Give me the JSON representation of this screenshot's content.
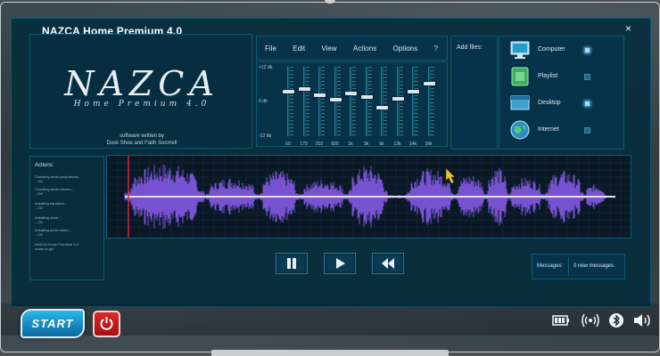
{
  "window": {
    "title": "NAZCA Home Premium 4.0",
    "close_label": "×"
  },
  "logo": {
    "wordmark": "NAZCA",
    "subtitle": "Home Premium 4.0",
    "credit_line1": "software written by",
    "credit_line2": "Dusk Shoe and Faith Socmell"
  },
  "menu": {
    "items": [
      "File",
      "Edit",
      "View",
      "Actions",
      "Options",
      "?"
    ]
  },
  "equalizer": {
    "ticks": [
      "+12 db",
      "0 db",
      "-12 db"
    ],
    "bands": [
      {
        "label": "60",
        "level": 0.35
      },
      {
        "label": "170",
        "level": 0.45
      },
      {
        "label": "310",
        "level": 0.25
      },
      {
        "label": "600",
        "level": 0.1
      },
      {
        "label": "1k",
        "level": 0.3
      },
      {
        "label": "3k",
        "level": 0.2
      },
      {
        "label": "6k",
        "level": -0.15
      },
      {
        "label": "12k",
        "level": 0.15
      },
      {
        "label": "14k",
        "level": 0.35
      },
      {
        "label": "16k",
        "level": 0.6
      }
    ]
  },
  "add_files": {
    "label": "Add files:",
    "destinations": [
      {
        "label": "Computer",
        "icon": "monitor-icon",
        "selected": true
      },
      {
        "label": "Playlist",
        "icon": "playlist-icon",
        "selected": false
      },
      {
        "label": "Desktop",
        "icon": "desktop-icon",
        "selected": true
      },
      {
        "label": "Internet",
        "icon": "globe-icon",
        "selected": false
      }
    ]
  },
  "actions": {
    "title": "Actions:",
    "log": [
      {
        "line1": "Checking audio peripherals...",
        "line2": "...OK"
      },
      {
        "line1": "Checking audio drivers...",
        "line2": "...OK"
      },
      {
        "line1": "Installing equalizer...",
        "line2": "...OK"
      },
      {
        "line1": "Installing mixer...",
        "line2": "...OK"
      },
      {
        "line1": "Installing audio editor...",
        "line2": "...OK"
      },
      {
        "line1": "NAZCA Home Premium 4.0",
        "line2": "ready to go!"
      }
    ]
  },
  "controls": {
    "pause_icon": "pause-icon",
    "play_icon": "play-icon",
    "rewind_icon": "rewind-icon"
  },
  "messages": {
    "label": "Messages:",
    "text": "0 new messages."
  },
  "taskbar": {
    "start_label": "START",
    "tray_icons": [
      "battery-icon",
      "wireless-icon",
      "bluetooth-icon",
      "volume-icon"
    ]
  },
  "colors": {
    "waveform": "#8a5cf0",
    "waveform_core": "#e8dcff",
    "playhead": "#e0203a",
    "start_button": "#1e96d0",
    "power_button": "#d11c1f"
  }
}
